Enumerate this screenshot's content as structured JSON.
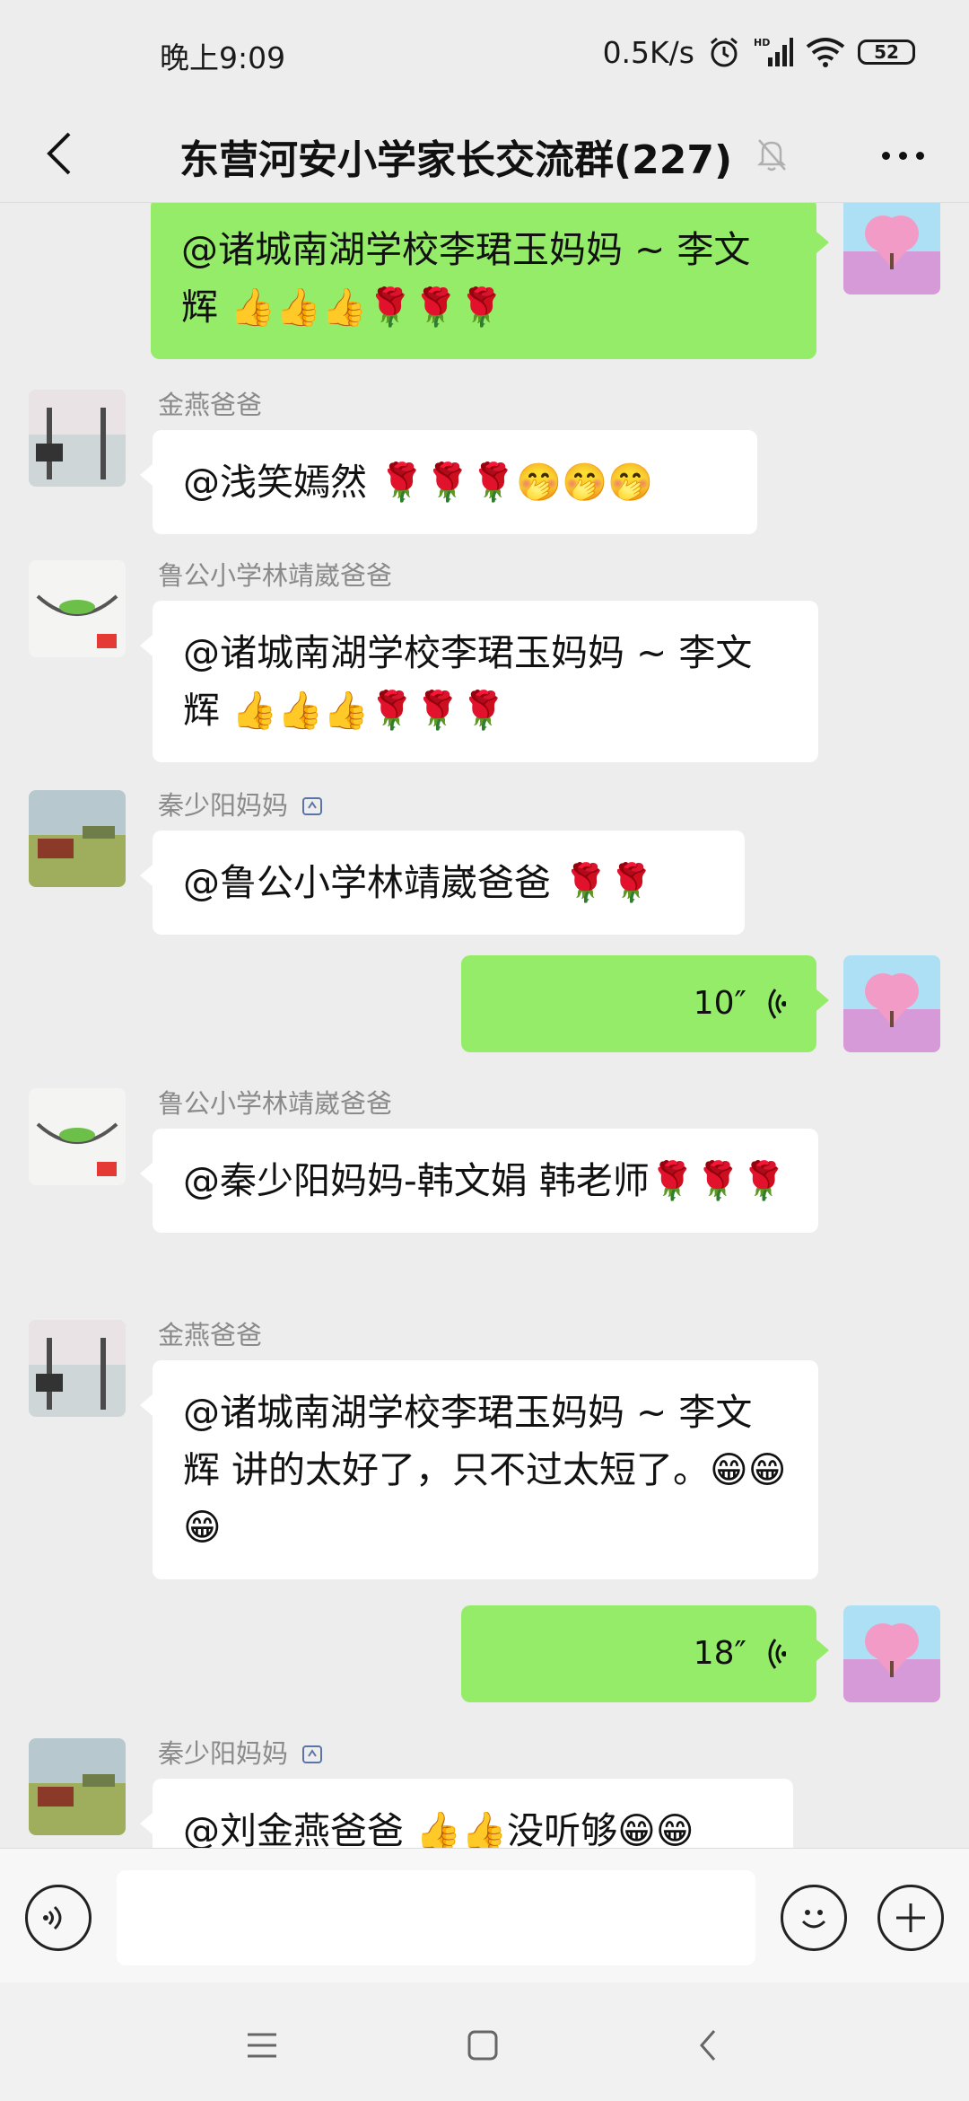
{
  "status_bar": {
    "time": "晚上9:09",
    "net_speed": "0.5K/s",
    "battery": "52"
  },
  "header": {
    "title": "东营河安小学家长交流群(227)"
  },
  "messages": [
    {
      "side": "out",
      "text": "@诸城南湖学校李珺玉妈妈 ~ 李文辉 👍👍👍🌹🌹🌹"
    },
    {
      "side": "in",
      "sender": "金燕爸爸",
      "text": "@浅笑嫣然 🌹🌹🌹🤭🤭🤭"
    },
    {
      "side": "in",
      "sender": "鲁公小学林靖崴爸爸",
      "text": "@诸城南湖学校李珺玉妈妈 ~ 李文辉 👍👍👍🌹🌹🌹"
    },
    {
      "side": "in",
      "sender": "秦少阳妈妈",
      "text": "@鲁公小学林靖崴爸爸 🌹🌹"
    },
    {
      "side": "out",
      "voice": "10″"
    },
    {
      "side": "in",
      "sender": "鲁公小学林靖崴爸爸",
      "text": "@秦少阳妈妈-韩文娟 韩老师🌹🌹🌹"
    },
    {
      "side": "in",
      "sender": "金燕爸爸",
      "text": "@诸城南湖学校李珺玉妈妈 ~ 李文辉 讲的太好了，只不过太短了。😁😁😁"
    },
    {
      "side": "out",
      "voice": "18″"
    },
    {
      "side": "in",
      "sender": "秦少阳妈妈",
      "text": "@刘金燕爸爸 👍👍没听够😁😁"
    }
  ],
  "colors": {
    "bubble_out": "#95ec69",
    "bubble_in": "#ffffff",
    "background": "#ededed"
  }
}
